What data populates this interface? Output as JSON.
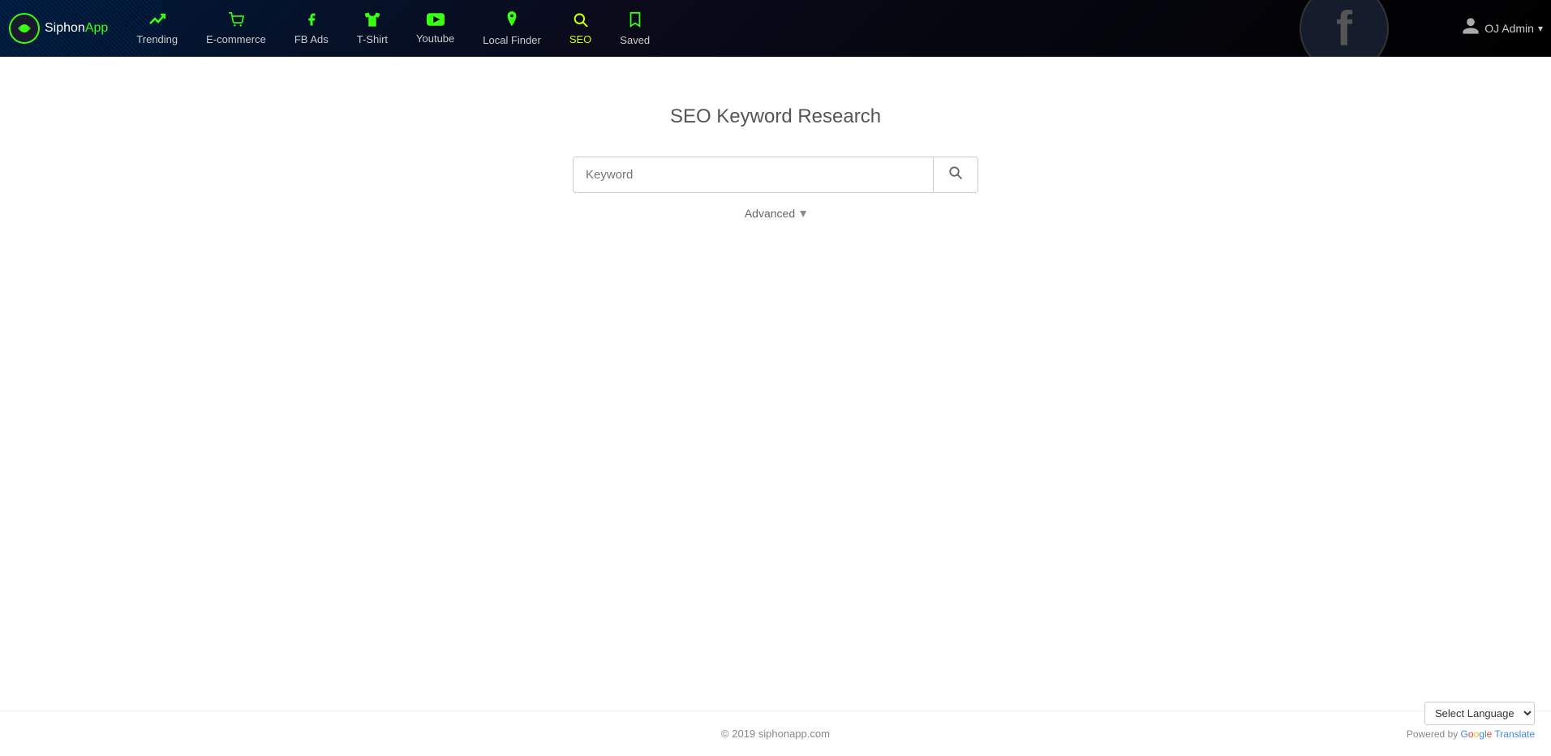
{
  "logo": {
    "siphon": "Siphon",
    "app": "App"
  },
  "nav": {
    "items": [
      {
        "id": "trending",
        "label": "Trending",
        "icon": "trending-icon",
        "active": false
      },
      {
        "id": "ecommerce",
        "label": "E-commerce",
        "icon": "cart-icon",
        "active": false
      },
      {
        "id": "fbads",
        "label": "FB Ads",
        "icon": "fb-icon",
        "active": false
      },
      {
        "id": "tshirt",
        "label": "T-Shirt",
        "icon": "tshirt-icon",
        "active": false
      },
      {
        "id": "youtube",
        "label": "Youtube",
        "icon": "youtube-icon",
        "active": false
      },
      {
        "id": "localfinder",
        "label": "Local Finder",
        "icon": "pin-icon",
        "active": false
      },
      {
        "id": "seo",
        "label": "SEO",
        "icon": "seo-icon",
        "active": true
      },
      {
        "id": "saved",
        "label": "Saved",
        "icon": "saved-icon",
        "active": false
      }
    ]
  },
  "profile": {
    "name": "OJ Admin",
    "dropdown": "▾"
  },
  "main": {
    "title": "SEO Keyword Research",
    "search": {
      "placeholder": "Keyword",
      "button_label": "🔍"
    },
    "advanced": {
      "label": "Advanced",
      "arrow": "▾"
    }
  },
  "footer": {
    "text": "© 2019 siphonapp.com"
  },
  "language_selector": {
    "label": "Select Language",
    "powered_by": "Powered by",
    "google": "Google",
    "translate": "Translate"
  }
}
